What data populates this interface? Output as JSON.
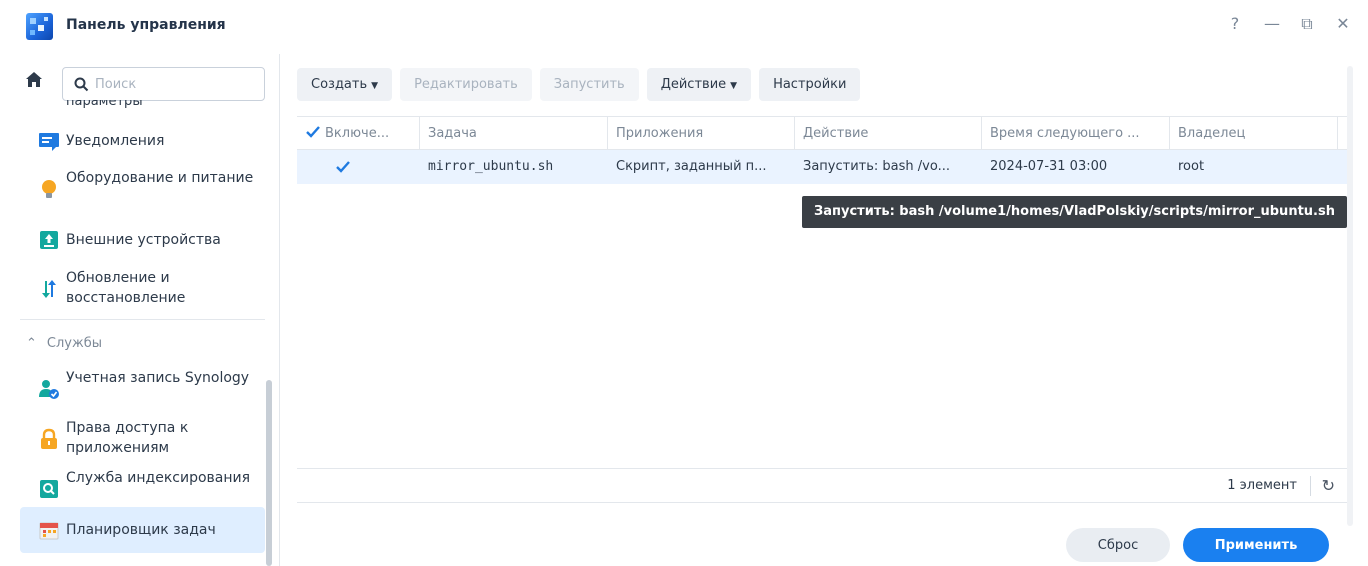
{
  "window": {
    "title": "Панель управления",
    "controls": {
      "help": "?",
      "minimize": "—",
      "restore": "⧉",
      "close": "✕"
    }
  },
  "sidebar": {
    "search_placeholder": "Поиск",
    "cut_text": "параметры",
    "items": [
      {
        "label": "Уведомления",
        "icon": "notifications-icon"
      },
      {
        "label": "Оборудование и питание",
        "icon": "hardware-power-icon"
      },
      {
        "label": "Внешние устройства",
        "icon": "external-devices-icon"
      },
      {
        "label": "Обновление и восстановление",
        "icon": "update-restore-icon"
      }
    ],
    "section": "Службы",
    "section_items": [
      {
        "label": "Учетная запись Synology",
        "icon": "synology-account-icon"
      },
      {
        "label": "Права доступа к приложениям",
        "icon": "app-privileges-icon"
      },
      {
        "label": "Служба индексирования",
        "icon": "indexing-service-icon"
      },
      {
        "label": "Планировщик задач",
        "icon": "task-scheduler-icon",
        "active": true
      }
    ]
  },
  "toolbar": {
    "create": "Создать",
    "edit": "Редактировать",
    "run": "Запустить",
    "action": "Действие",
    "settings": "Настройки"
  },
  "table": {
    "columns": [
      "Включе...",
      "Задача",
      "Приложения",
      "Действие",
      "Время следующего ...",
      "Владелец"
    ],
    "rows": [
      {
        "enabled": true,
        "task": "mirror_ubuntu.sh",
        "app": "Скрипт, заданный п...",
        "action": "Запустить: bash /vo...",
        "next_run": "2024-07-31 03:00",
        "owner": "root"
      }
    ],
    "count": "1 элемент"
  },
  "tooltip": "Запустить: bash /volume1/homes/VladPolskiy/scripts/mirror_ubuntu.sh",
  "footer": {
    "reset": "Сброс",
    "apply": "Применить"
  },
  "colors": {
    "accent": "#1a80f0",
    "row_selected": "#eaf3ff",
    "active_nav": "#dfeeff"
  }
}
